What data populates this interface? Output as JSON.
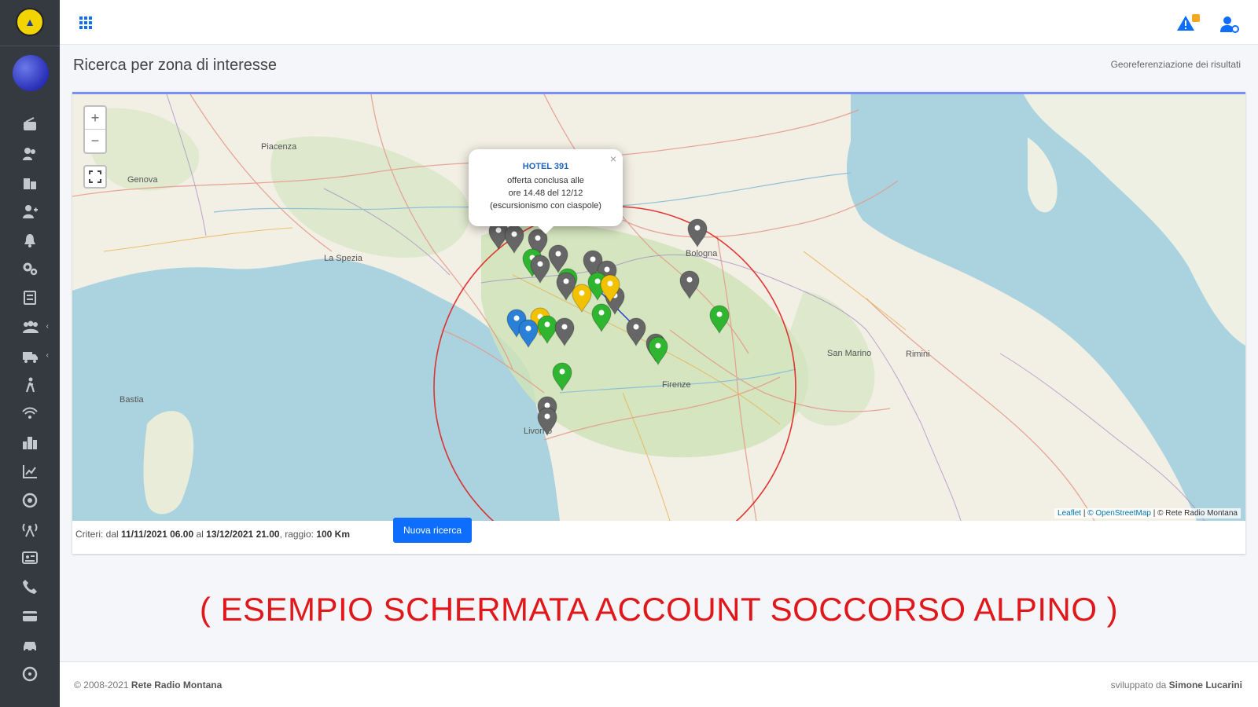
{
  "colors": {
    "sidebar": "#343a40",
    "accent": "#0d6efd",
    "watermark": "#e0181b",
    "marker_green": "#2fb52f",
    "marker_gray": "#666666",
    "marker_yellow": "#f2c200",
    "marker_blue": "#2a7fd6",
    "radius_circle": "#e02020"
  },
  "sidebar": {
    "items": [
      {
        "icon": "radio-icon"
      },
      {
        "icon": "users-icon"
      },
      {
        "icon": "buildings-icon"
      },
      {
        "icon": "user-plus-icon"
      },
      {
        "icon": "bell-icon"
      },
      {
        "icon": "cogs-icon"
      },
      {
        "icon": "list-icon"
      },
      {
        "icon": "group-icon",
        "caret": "‹"
      },
      {
        "icon": "truck-icon",
        "caret": "‹"
      },
      {
        "icon": "person-walking-icon"
      },
      {
        "icon": "wifi-icon"
      },
      {
        "icon": "city-icon"
      },
      {
        "icon": "chart-icon"
      },
      {
        "icon": "target-icon"
      },
      {
        "icon": "antenna-icon"
      },
      {
        "icon": "id-card-icon"
      },
      {
        "icon": "phone-icon"
      },
      {
        "icon": "credit-card-icon"
      },
      {
        "icon": "car-icon"
      },
      {
        "icon": "help-icon"
      }
    ]
  },
  "page": {
    "title": "Ricerca per zona di interesse",
    "breadcrumb": "Georeferenziazione dei risultati"
  },
  "map": {
    "zoom_in": "+",
    "zoom_out": "−",
    "popup": {
      "title": "HOTEL 391",
      "line1": "offerta conclusa alle",
      "line2": "ore 14.48 del 12/12",
      "line3": "(escursionismo con ciaspole)",
      "close": "×"
    },
    "attribution_leaflet": "Leaflet",
    "attribution_osm": "© OpenStreetMap",
    "attribution_rrm": "© Rete Radio Montana",
    "sep": " | ",
    "labels": {
      "la_spezia": "La Spezia",
      "livorno": "Livorno",
      "firenze": "Firenze",
      "san_marino": "San Marino",
      "bologna": "Bologna",
      "piacenza": "Piacenza",
      "genova": "Genova",
      "bastia": "Bastia",
      "rimini": "Rimini"
    }
  },
  "criteria": {
    "prefix": "Criteri: dal",
    "from": "11/11/2021 06.00",
    "mid": "al",
    "to": "13/12/2021 21.00",
    "radius_label": ", raggio:",
    "radius": "100 Km"
  },
  "button_new_search": "Nuova ricerca",
  "watermark": "( ESEMPIO SCHERMATA ACCOUNT SOCCORSO ALPINO )",
  "footer": {
    "copyright": "© 2008-2021",
    "org": "Rete Radio Montana",
    "dev_prefix": "sviluppato da",
    "dev": "Simone Lucarini"
  }
}
